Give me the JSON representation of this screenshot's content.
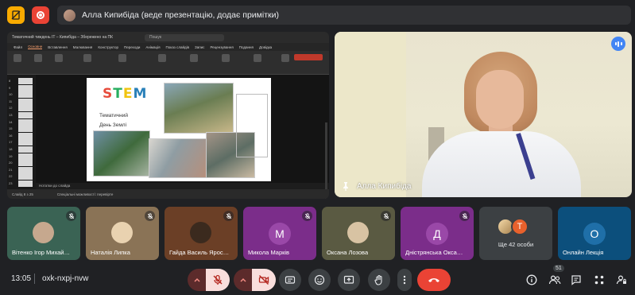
{
  "top": {
    "presenter_text": "Алла Кипибіда (веде презентацію, додає примітки)"
  },
  "presentation": {
    "titlebar": "Тематичний тиждень ІТ – Кипибіда – Збережено на ПК",
    "search": "Пошук",
    "tabs": [
      "Файл",
      "Основне",
      "Вставлення",
      "Малювання",
      "Конструктор",
      "Переходи",
      "Анімація",
      "Показ слайдів",
      "Запис",
      "Рецензування",
      "Подання",
      "Довідка"
    ],
    "slide_title_line1": "Тематичний",
    "slide_title_line2": "День Землі",
    "stem_letters": [
      "S",
      "T",
      "E",
      "M"
    ],
    "notes": "Нотатки до слайда",
    "status_left": "Слайд 8 з 25",
    "status_mid": "Спеціальні можливості: перевірте",
    "thumb_numbers": [
      "8",
      "9",
      "10",
      "11",
      "12",
      "13",
      "14",
      "15",
      "16",
      "17",
      "18",
      "19",
      "20",
      "21",
      "22",
      "23"
    ]
  },
  "speaker": {
    "name": "Алла Кипибіда"
  },
  "participants": [
    {
      "name": "Вітенко Ігор Михай…",
      "bg": "#3a6354",
      "kind": "photo",
      "photo": "#c6a88e"
    },
    {
      "name": "Наталія Липка",
      "bg": "#8a7356",
      "kind": "photo",
      "photo": "#e9d2b0"
    },
    {
      "name": "Гайда Василь Ярос…",
      "bg": "#6b3f26",
      "kind": "photo",
      "photo": "#3b2a1e"
    },
    {
      "name": "Микола Марків",
      "bg": "#7b2d8a",
      "kind": "letter",
      "letter": "М",
      "letter_bg": "#9a48a8"
    },
    {
      "name": "Оксана Лозова",
      "bg": "#5a5a42",
      "kind": "photo",
      "photo": "#d8c3a3"
    },
    {
      "name": "Дністрянська Окса…",
      "bg": "#7b2d8a",
      "kind": "letter",
      "letter": "Д",
      "letter_bg": "#9a48a8"
    }
  ],
  "more": {
    "label": "Ще 42 особи",
    "letter": "T"
  },
  "lecture": {
    "name": "Онлайн Лекція",
    "letter": "О",
    "bg": "#0c4f7c",
    "letter_bg": "#1f6fa8"
  },
  "bottom": {
    "time": "13:05",
    "code": "oxk-nxpj-nvw",
    "people_count": "51"
  }
}
